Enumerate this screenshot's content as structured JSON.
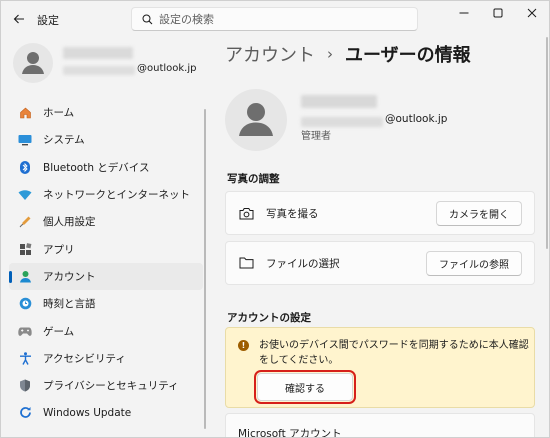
{
  "window": {
    "title": "設定",
    "search_placeholder": "設定の検索"
  },
  "profile": {
    "email_suffix": "@outlook.jp"
  },
  "nav": {
    "items": [
      {
        "label": "ホーム",
        "icon": "home-icon"
      },
      {
        "label": "システム",
        "icon": "system-icon"
      },
      {
        "label": "Bluetooth とデバイス",
        "icon": "bluetooth-icon"
      },
      {
        "label": "ネットワークとインターネット",
        "icon": "network-icon"
      },
      {
        "label": "個人用設定",
        "icon": "personalization-icon"
      },
      {
        "label": "アプリ",
        "icon": "apps-icon"
      },
      {
        "label": "アカウント",
        "icon": "account-icon"
      },
      {
        "label": "時刻と言語",
        "icon": "time-language-icon"
      },
      {
        "label": "ゲーム",
        "icon": "gaming-icon"
      },
      {
        "label": "アクセシビリティ",
        "icon": "accessibility-icon"
      },
      {
        "label": "プライバシーとセキュリティ",
        "icon": "privacy-shield-icon"
      },
      {
        "label": "Windows Update",
        "icon": "windows-update-icon"
      }
    ],
    "active_index": 6
  },
  "breadcrumb": {
    "parent": "アカウント",
    "separator": "›",
    "current": "ユーザーの情報"
  },
  "user": {
    "email_suffix": "@outlook.jp",
    "role": "管理者"
  },
  "photo_section": {
    "title": "写真の調整",
    "take_photo_label": "写真を撮る",
    "open_camera_button": "カメラを開く",
    "choose_file_label": "ファイルの選択",
    "browse_files_button": "ファイルの参照"
  },
  "account_settings": {
    "title": "アカウントの設定",
    "warning_text": "お使いのデバイス間でパスワードを同期するために本人確認をしてください。",
    "verify_button": "確認する",
    "microsoft_account_label": "Microsoft アカウント"
  },
  "colors": {
    "accent": "#005fb8",
    "warning_bg": "#fff4ce",
    "highlight_box": "#d6201a"
  }
}
